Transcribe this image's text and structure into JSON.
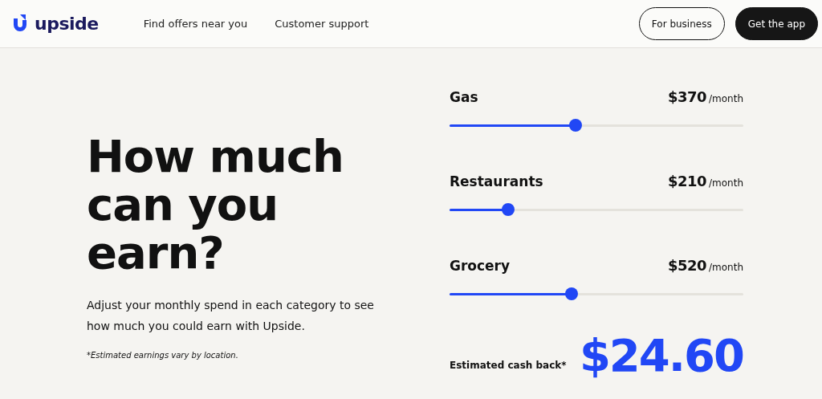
{
  "header": {
    "logo": "upside",
    "nav": [
      "Find offers near you",
      "Customer support"
    ],
    "buttons": [
      {
        "label": "For business",
        "kind": "outline"
      },
      {
        "label": "Get the app",
        "kind": "solid"
      }
    ]
  },
  "intro": {
    "heading": "How much can you earn?",
    "description": "Adjust your monthly spend in each category to see how much you could earn with Upside.",
    "note": "*Estimated earnings vary by location."
  },
  "sliders": [
    {
      "name": "Gas",
      "amount": "$370",
      "unit": "/month",
      "level": 0.43
    },
    {
      "name": "Restaurants",
      "amount": "$210",
      "unit": "/month",
      "level": 0.2
    },
    {
      "name": "Grocery",
      "amount": "$520",
      "unit": "/month",
      "level": 0.415
    }
  ],
  "result": {
    "label": "Estimated cash back*",
    "value": "$24.60"
  }
}
